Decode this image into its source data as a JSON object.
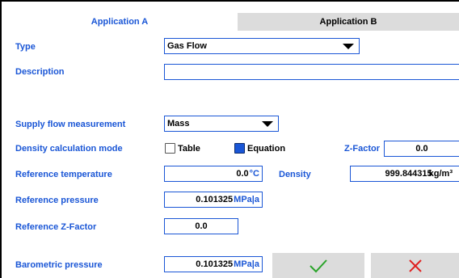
{
  "tabs": [
    {
      "label": "Application A",
      "active": true
    },
    {
      "label": "Application B",
      "active": false
    }
  ],
  "fields": {
    "type": {
      "label": "Type",
      "value": "Gas Flow"
    },
    "description": {
      "label": "Description",
      "value": ""
    },
    "supply_flow": {
      "label": "Supply flow measurement",
      "value": "Mass"
    },
    "density_mode": {
      "label": "Density calculation mode",
      "options": [
        {
          "label": "Table",
          "selected": false
        },
        {
          "label": "Equation",
          "selected": true
        }
      ]
    },
    "z_factor": {
      "label": "Z-Factor",
      "value": "0.0"
    },
    "ref_temp": {
      "label": "Reference temperature",
      "value": "0.0",
      "unit": "°C"
    },
    "density": {
      "label": "Density",
      "value": "999.844315",
      "unit": "kg/m³"
    },
    "ref_pressure": {
      "label": "Reference pressure",
      "value": "0.101325",
      "unit": "MPa|a"
    },
    "ref_z": {
      "label": "Reference Z-Factor",
      "value": "0.0"
    },
    "baro": {
      "label": "Barometric pressure",
      "value": "0.101325",
      "unit": "MPa|a"
    }
  },
  "buttons": {
    "confirm_icon": "check-icon",
    "cancel_icon": "close-icon"
  },
  "colors": {
    "accent": "#1a56d6",
    "confirm": "#2aa42a",
    "cancel": "#e02020",
    "tab_inactive": "#dcdcdc"
  }
}
